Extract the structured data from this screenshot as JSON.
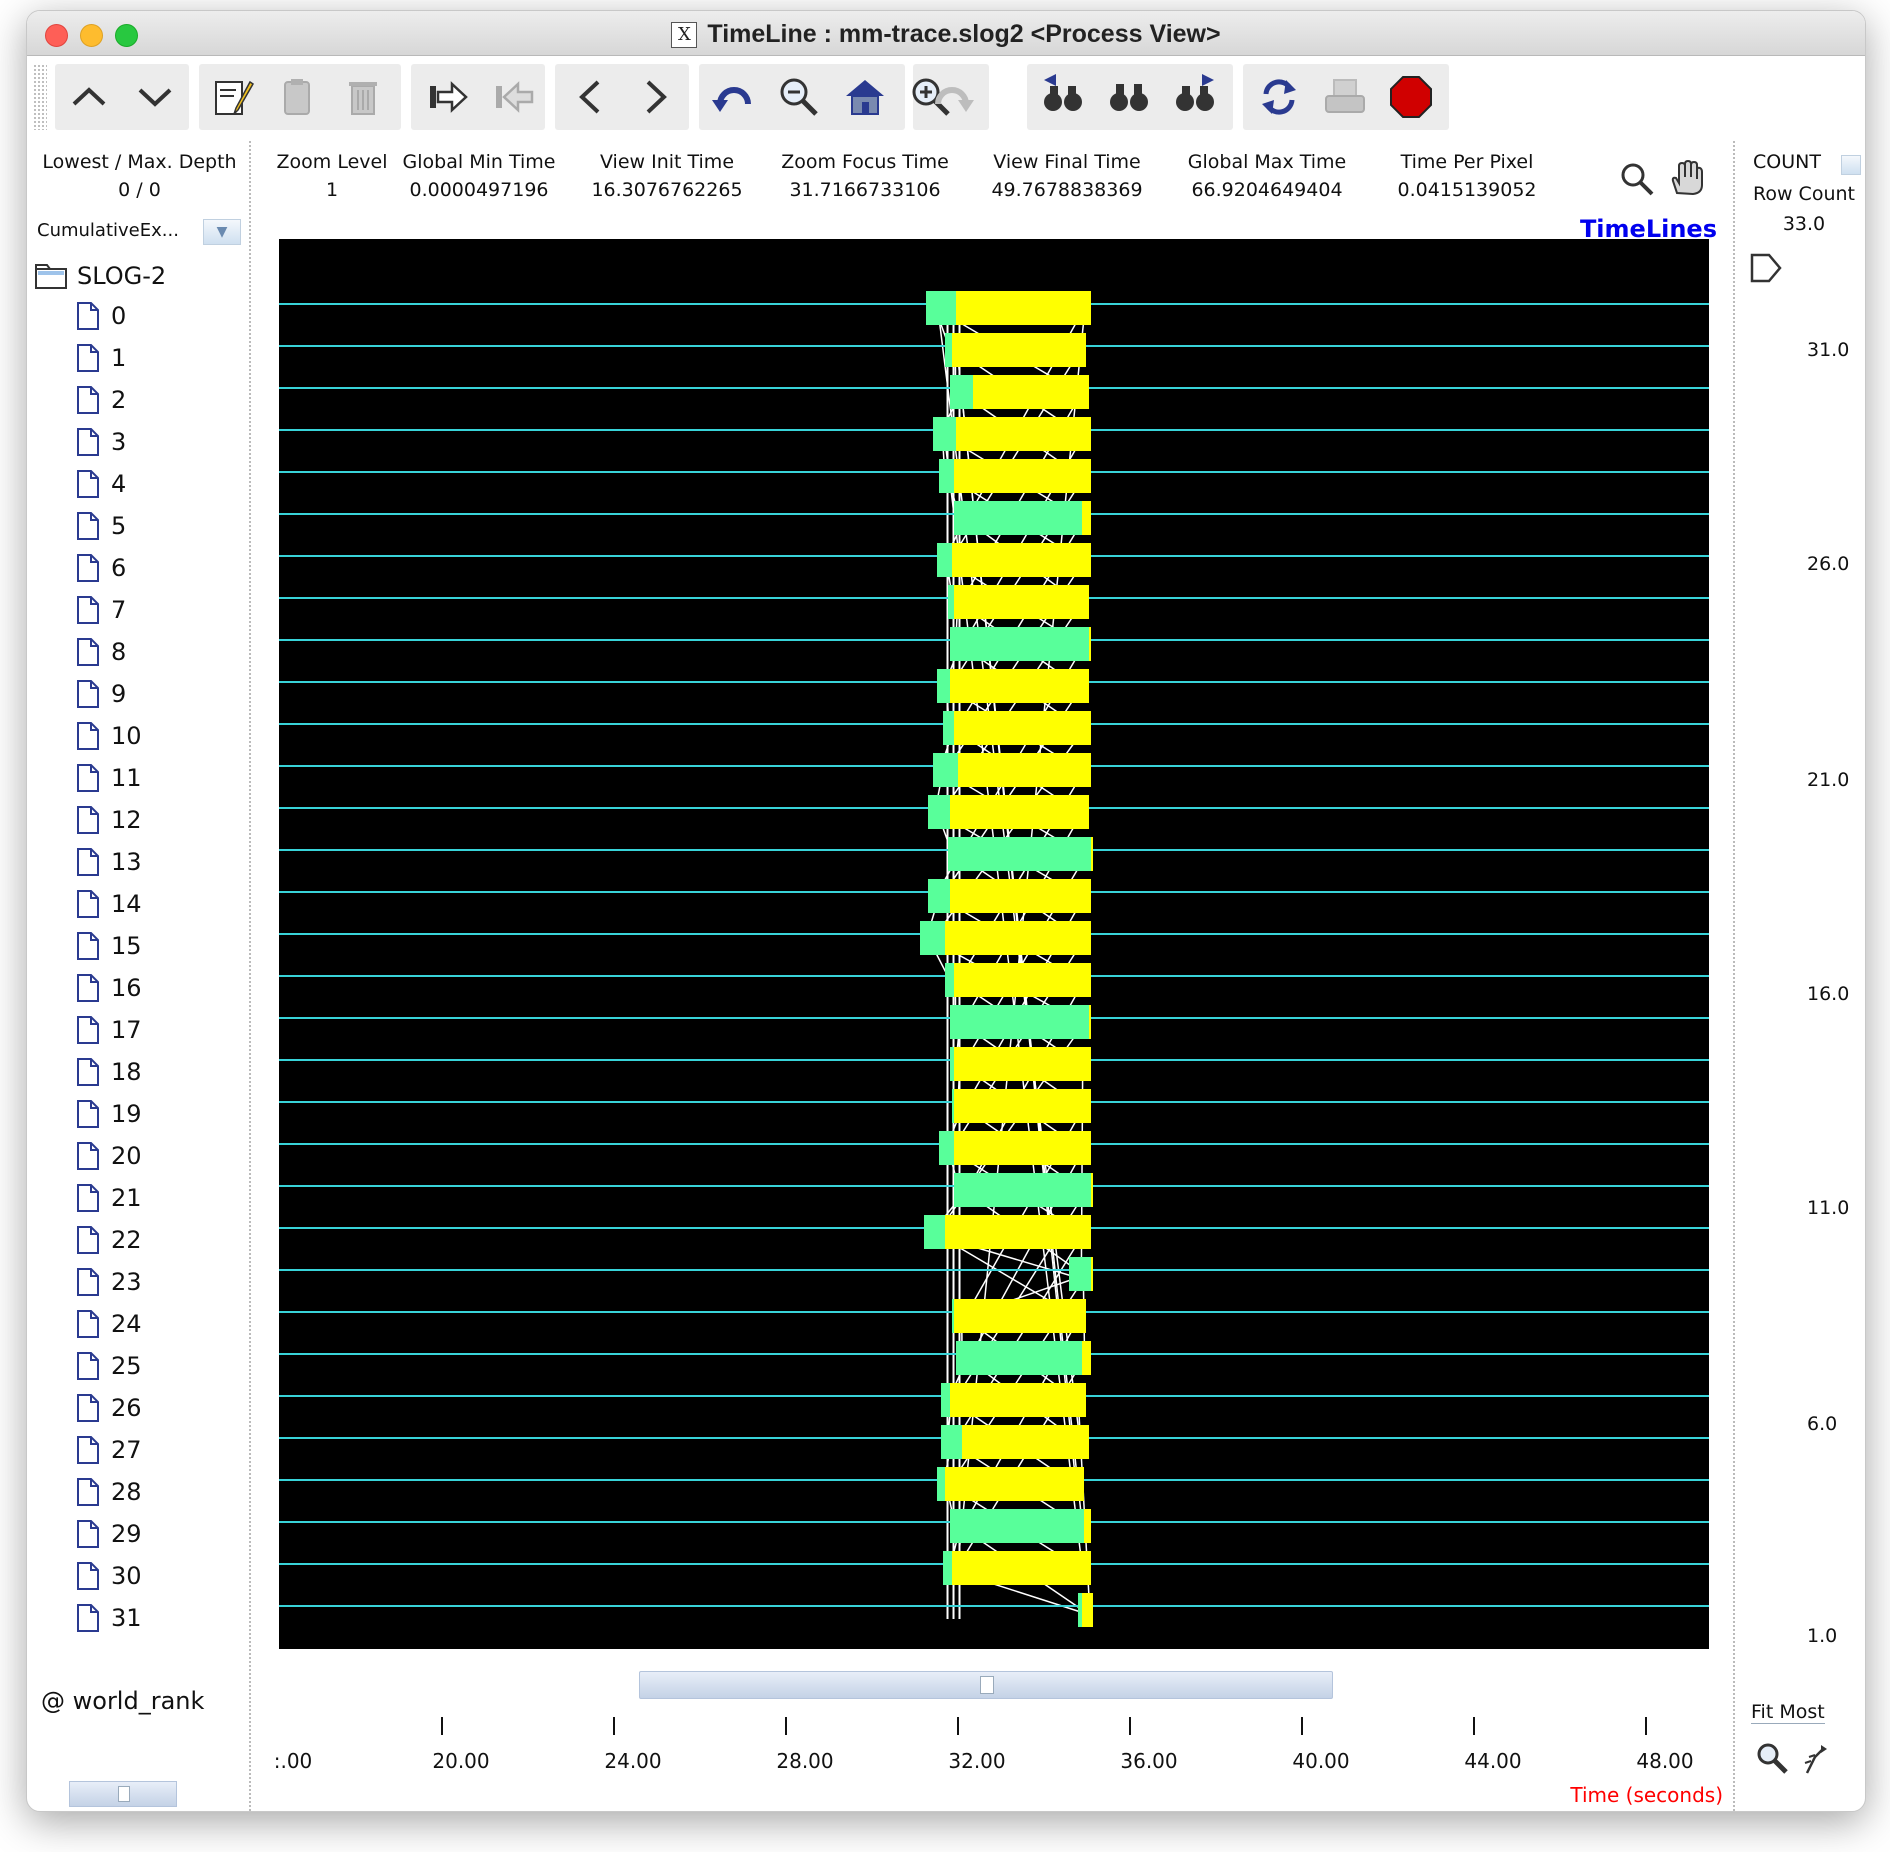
{
  "window": {
    "title": "TimeLine : mm-trace.slog2  <Process View>",
    "x_icon": "X"
  },
  "toolbar": {
    "buttons": [
      {
        "name": "scroll-up-icon"
      },
      {
        "name": "scroll-down-icon"
      },
      {
        "name": "edit-icon"
      },
      {
        "name": "paste-icon"
      },
      {
        "name": "delete-icon"
      },
      {
        "name": "indent-icon"
      },
      {
        "name": "outdent-icon"
      },
      {
        "name": "backward-icon"
      },
      {
        "name": "forward-icon"
      },
      {
        "name": "zoom-undo-icon"
      },
      {
        "name": "zoom-out-icon"
      },
      {
        "name": "zoom-home-icon"
      },
      {
        "name": "zoom-in-icon"
      },
      {
        "name": "zoom-redo-icon"
      },
      {
        "name": "search-backward-icon"
      },
      {
        "name": "search-init-icon"
      },
      {
        "name": "search-forward-icon"
      },
      {
        "name": "refresh-icon"
      },
      {
        "name": "print-icon"
      },
      {
        "name": "stop-icon"
      }
    ]
  },
  "left": {
    "depth_label": "Lowest / Max. Depth",
    "depth_value": "0 / 0",
    "cumulative_label": "CumulativeEx...",
    "root_label": "SLOG-2",
    "items": [
      "0",
      "1",
      "2",
      "3",
      "4",
      "5",
      "6",
      "7",
      "8",
      "9",
      "10",
      "11",
      "12",
      "13",
      "14",
      "15",
      "16",
      "17",
      "18",
      "19",
      "20",
      "21",
      "22",
      "23",
      "24",
      "25",
      "26",
      "27",
      "28",
      "29",
      "30",
      "31"
    ],
    "footer_label": "@ world_rank"
  },
  "header": {
    "zoom_level_label": "Zoom Level",
    "zoom_level_value": "1",
    "global_min_label": "Global Min Time",
    "global_min_value": "0.0000497196",
    "view_init_label": "View  Init Time",
    "view_init_value": "16.3076762265",
    "zoom_focus_label": "Zoom Focus Time",
    "zoom_focus_value": "31.7166733106",
    "view_final_label": "View Final Time",
    "view_final_value": "49.7678838369",
    "global_max_label": "Global Max Time",
    "global_max_value": "66.9204649404",
    "time_per_pixel_label": "Time Per Pixel",
    "time_per_pixel_value": "0.0415139052",
    "timelines_label": "TimeLines"
  },
  "right": {
    "count_label": "COUNT",
    "row_count_label": "Row Count",
    "row_count_value": "33.0",
    "y_ticks": [
      "31.0",
      "26.0",
      "21.0",
      "16.0",
      "11.0",
      "6.0",
      "1.0"
    ],
    "fit_label": "Fit Most"
  },
  "axis": {
    "x_ticks": [
      ":.00",
      "20.00",
      "24.00",
      "28.00",
      "32.00",
      "36.00",
      "40.00",
      "44.00",
      "48.00"
    ],
    "x_title": "Time (seconds)"
  },
  "colors": {
    "state_compute": "#ffff00",
    "state_comm": "#58ff9a",
    "timeline_line": "#38d3d8",
    "canvas_bg": "#000000",
    "axis_title": "#ff0000",
    "timelines_label": "#0000ee"
  },
  "chart_data": {
    "type": "timeline",
    "x_range": [
      16.3076762265,
      49.7678838369
    ],
    "rows": 32,
    "states": [
      {
        "rank": 0,
        "green": [
          31.45,
          32.15
        ],
        "yellow": [
          32.15,
          35.3
        ]
      },
      {
        "rank": 1,
        "green": [
          31.9,
          32.05
        ],
        "yellow": [
          32.05,
          35.2
        ]
      },
      {
        "rank": 2,
        "green": [
          32.0,
          32.55
        ],
        "yellow": [
          32.55,
          35.25
        ]
      },
      {
        "rank": 3,
        "green": [
          31.6,
          32.15
        ],
        "yellow": [
          32.15,
          35.3
        ]
      },
      {
        "rank": 4,
        "green": [
          31.75,
          32.1
        ],
        "yellow": [
          32.1,
          35.3
        ]
      },
      {
        "rank": 5,
        "green": [
          32.1,
          35.1
        ],
        "yellow": [
          35.1,
          35.3
        ]
      },
      {
        "rank": 6,
        "green": [
          31.7,
          32.05
        ],
        "yellow": [
          32.05,
          35.3
        ]
      },
      {
        "rank": 7,
        "green": [
          31.95,
          32.1
        ],
        "yellow": [
          32.1,
          35.25
        ]
      },
      {
        "rank": 8,
        "green": [
          32.0,
          35.25
        ],
        "yellow": [
          35.25,
          35.3
        ]
      },
      {
        "rank": 9,
        "green": [
          31.7,
          32.0
        ],
        "yellow": [
          32.0,
          35.25
        ]
      },
      {
        "rank": 10,
        "green": [
          31.85,
          32.1
        ],
        "yellow": [
          32.1,
          35.3
        ]
      },
      {
        "rank": 11,
        "green": [
          31.6,
          32.2
        ],
        "yellow": [
          32.2,
          35.3
        ]
      },
      {
        "rank": 12,
        "green": [
          31.5,
          32.0
        ],
        "yellow": [
          32.0,
          35.25
        ]
      },
      {
        "rank": 13,
        "green": [
          31.95,
          35.3
        ],
        "yellow": [
          35.3,
          35.35
        ]
      },
      {
        "rank": 14,
        "green": [
          31.5,
          32.0
        ],
        "yellow": [
          32.0,
          35.3
        ]
      },
      {
        "rank": 15,
        "green": [
          31.3,
          31.9
        ],
        "yellow": [
          31.9,
          35.3
        ]
      },
      {
        "rank": 16,
        "green": [
          31.9,
          32.1
        ],
        "yellow": [
          32.1,
          35.3
        ]
      },
      {
        "rank": 17,
        "green": [
          32.0,
          35.25
        ],
        "yellow": [
          35.25,
          35.3
        ]
      },
      {
        "rank": 18,
        "green": [
          32.0,
          32.1
        ],
        "yellow": [
          32.1,
          35.3
        ]
      },
      {
        "rank": 19,
        "green": [
          32.05,
          32.1
        ],
        "yellow": [
          32.1,
          35.3
        ]
      },
      {
        "rank": 20,
        "green": [
          31.75,
          32.1
        ],
        "yellow": [
          32.1,
          35.3
        ]
      },
      {
        "rank": 21,
        "green": [
          32.1,
          35.3
        ],
        "yellow": [
          35.3,
          35.35
        ]
      },
      {
        "rank": 22,
        "green": [
          31.4,
          31.9
        ],
        "yellow": [
          31.9,
          35.3
        ]
      },
      {
        "rank": 23,
        "green": [
          34.8,
          35.3
        ],
        "yellow": [
          35.3,
          35.35
        ]
      },
      {
        "rank": 24,
        "green": [
          32.05,
          32.1
        ],
        "yellow": [
          32.1,
          35.2
        ]
      },
      {
        "rank": 25,
        "green": [
          32.15,
          35.1
        ],
        "yellow": [
          35.1,
          35.3
        ]
      },
      {
        "rank": 26,
        "green": [
          31.8,
          32.0
        ],
        "yellow": [
          32.0,
          35.2
        ]
      },
      {
        "rank": 27,
        "green": [
          31.8,
          32.3
        ],
        "yellow": [
          32.3,
          35.25
        ]
      },
      {
        "rank": 28,
        "green": [
          31.7,
          31.9
        ],
        "yellow": [
          31.9,
          35.15
        ]
      },
      {
        "rank": 29,
        "green": [
          32.0,
          35.15
        ],
        "yellow": [
          35.15,
          35.3
        ]
      },
      {
        "rank": 30,
        "green": [
          31.85,
          32.05
        ],
        "yellow": [
          32.05,
          35.3
        ]
      },
      {
        "rank": 31,
        "green": [
          35.0,
          35.1
        ],
        "yellow": [
          35.1,
          35.35
        ]
      }
    ]
  }
}
